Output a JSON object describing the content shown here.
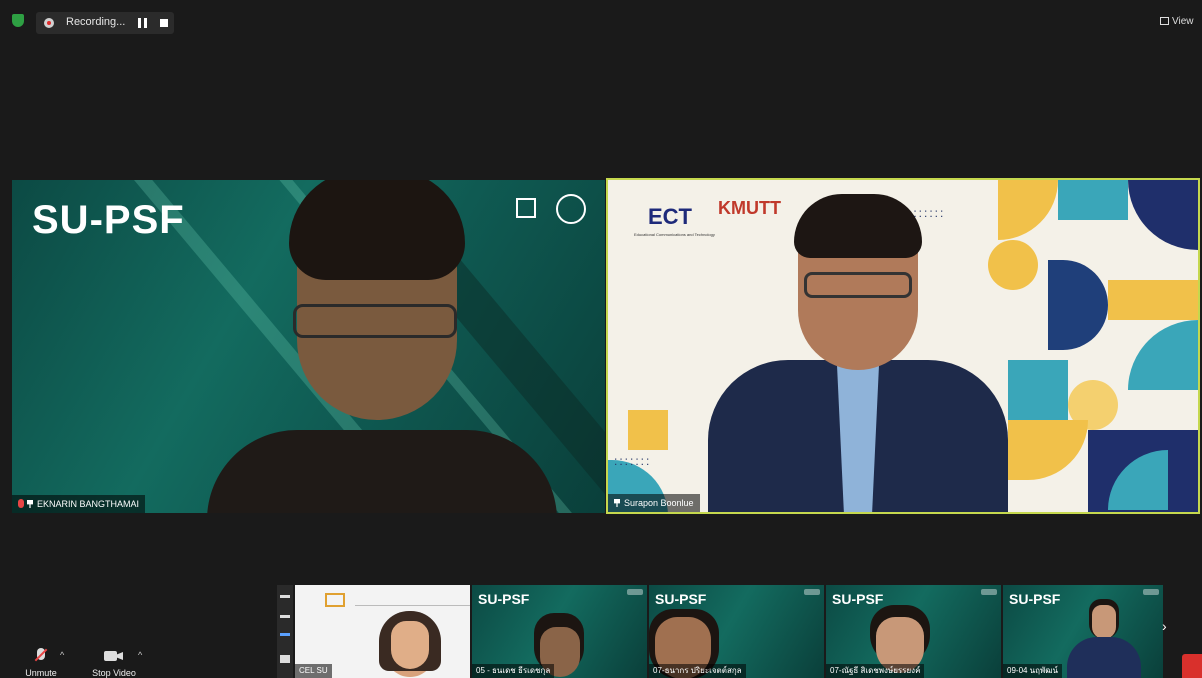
{
  "top_bar": {
    "recording_label": "Recording...",
    "view_label": "View"
  },
  "main_tiles": [
    {
      "name": "EKNARIN BANGTHAMAI",
      "brand_text": "SU-PSF",
      "muted": true,
      "pinned": true
    },
    {
      "name": "Surapon Boonlue",
      "logo_left": "ECT",
      "logo_left_sub": "Educational Communications and Technology",
      "logo_right": "KMUTT",
      "pinned": true,
      "active_speaker": true
    }
  ],
  "gallery_strip": {
    "thumbnails": [
      {
        "name": "CEL SU",
        "brand_text": ""
      },
      {
        "name": "05 - ธนเดช ธีรเดชกุล",
        "brand_text": "SU-PSF"
      },
      {
        "name": "07-ธนากร ปริยะเจตต์สกุล",
        "brand_text": "SU-PSF"
      },
      {
        "name": "07-ณัฐธี สิเดชพงษ์ยรรยงค์",
        "brand_text": "SU-PSF"
      },
      {
        "name": "09-04 นฤพัฒน์",
        "brand_text": "SU-PSF"
      }
    ]
  },
  "controls": {
    "unmute_label": "Unmute",
    "stop_video_label": "Stop Video"
  },
  "colors": {
    "active_speaker_border": "#c5d84e",
    "recording_dot": "#e02b2b",
    "security_shield": "#2ea043",
    "muted_mic": "#e84545"
  },
  "icons": [
    "shield-icon",
    "record-icon",
    "pause-icon",
    "stop-icon",
    "view-icon",
    "mic-muted-icon",
    "pin-icon",
    "video-camera-icon",
    "chevron-up-icon",
    "chevron-right-icon"
  ]
}
